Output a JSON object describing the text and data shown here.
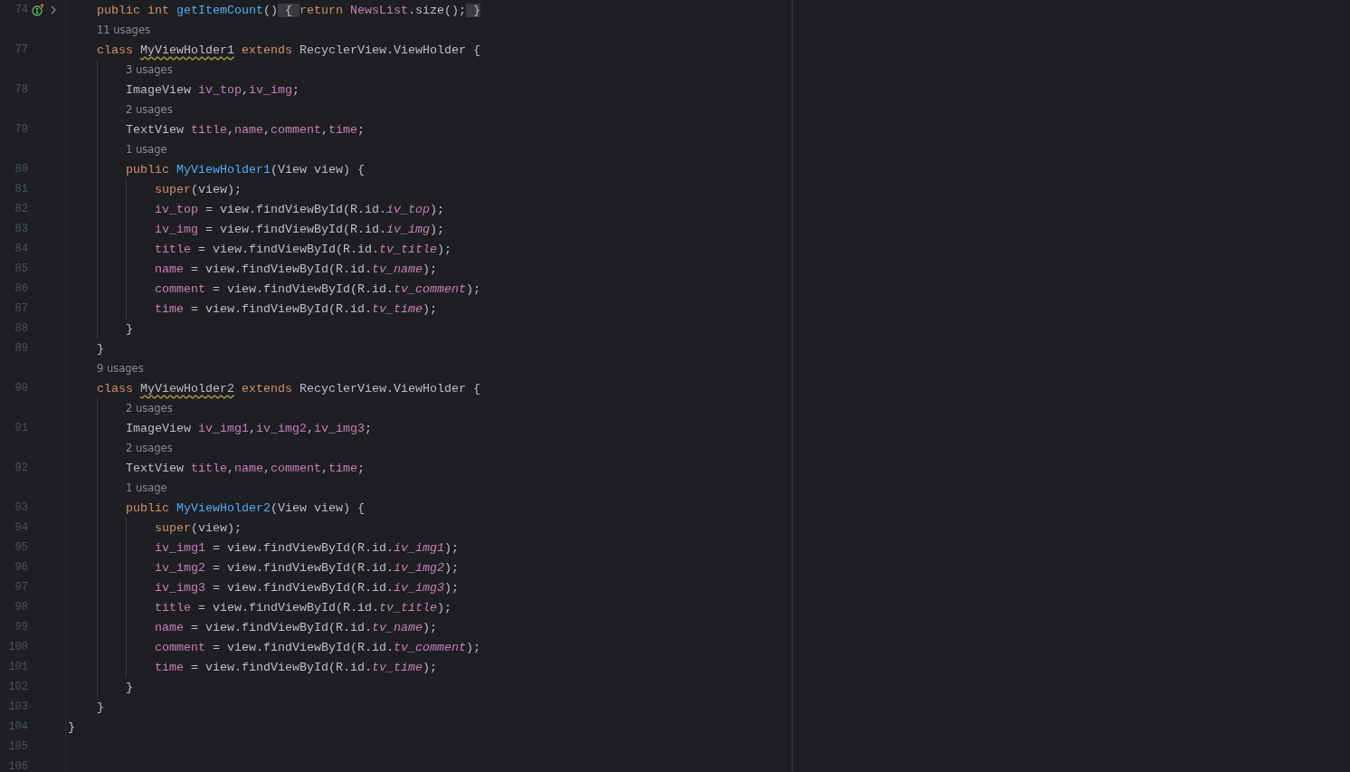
{
  "editor": {
    "lines": [
      {
        "number": "74",
        "markers": true,
        "tokens": [
          {
            "kind": "keyword",
            "text": "    public int "
          },
          {
            "kind": "method",
            "text": "getItemCount"
          },
          {
            "kind": "plain",
            "text": "()"
          },
          {
            "kind": "fold",
            "text": " { "
          },
          {
            "kind": "keyword",
            "text": "return "
          },
          {
            "kind": "field",
            "text": "NewsList"
          },
          {
            "kind": "plain",
            "text": ".size();"
          },
          {
            "kind": "fold",
            "text": " }"
          }
        ]
      },
      {
        "hint": "11 usages"
      },
      {
        "number": "77",
        "tokens": [
          {
            "kind": "keyword",
            "text": "    class "
          },
          {
            "kind": "warn",
            "text": "MyViewHolder1"
          },
          {
            "kind": "keyword",
            "text": " extends "
          },
          {
            "kind": "plain",
            "text": "RecyclerView.ViewHolder {"
          }
        ]
      },
      {
        "hint": "3 usages"
      },
      {
        "number": "78",
        "tokens": [
          {
            "kind": "plain",
            "text": "        ImageView "
          },
          {
            "kind": "field",
            "text": "iv_top"
          },
          {
            "kind": "plain",
            "text": ","
          },
          {
            "kind": "field",
            "text": "iv_img"
          },
          {
            "kind": "plain",
            "text": ";"
          }
        ]
      },
      {
        "hint": "2 usages"
      },
      {
        "number": "79",
        "tokens": [
          {
            "kind": "plain",
            "text": "        TextView "
          },
          {
            "kind": "field",
            "text": "title"
          },
          {
            "kind": "plain",
            "text": ","
          },
          {
            "kind": "field",
            "text": "name"
          },
          {
            "kind": "plain",
            "text": ","
          },
          {
            "kind": "field",
            "text": "comment"
          },
          {
            "kind": "plain",
            "text": ","
          },
          {
            "kind": "field",
            "text": "time"
          },
          {
            "kind": "plain",
            "text": ";"
          }
        ]
      },
      {
        "hint": "1 usage"
      },
      {
        "number": "80",
        "tokens": [
          {
            "kind": "keyword",
            "text": "        public "
          },
          {
            "kind": "method",
            "text": "MyViewHolder1"
          },
          {
            "kind": "plain",
            "text": "(View view) {"
          }
        ]
      },
      {
        "number": "81",
        "tokens": [
          {
            "kind": "keyword",
            "text": "            super"
          },
          {
            "kind": "plain",
            "text": "(view);"
          }
        ]
      },
      {
        "number": "82",
        "tokens": [
          {
            "kind": "field",
            "text": "            iv_top"
          },
          {
            "kind": "plain",
            "text": " = view.findViewById(R.id."
          },
          {
            "kind": "static",
            "text": "iv_top"
          },
          {
            "kind": "plain",
            "text": ");"
          }
        ]
      },
      {
        "number": "83",
        "tokens": [
          {
            "kind": "field",
            "text": "            iv_img"
          },
          {
            "kind": "plain",
            "text": " = view.findViewById(R.id."
          },
          {
            "kind": "static",
            "text": "iv_img"
          },
          {
            "kind": "plain",
            "text": ");"
          }
        ]
      },
      {
        "number": "84",
        "tokens": [
          {
            "kind": "field",
            "text": "            title"
          },
          {
            "kind": "plain",
            "text": " = view.findViewById(R.id."
          },
          {
            "kind": "static",
            "text": "tv_title"
          },
          {
            "kind": "plain",
            "text": ");"
          }
        ]
      },
      {
        "number": "85",
        "tokens": [
          {
            "kind": "field",
            "text": "            name"
          },
          {
            "kind": "plain",
            "text": " = view.findViewById(R.id."
          },
          {
            "kind": "static",
            "text": "tv_name"
          },
          {
            "kind": "plain",
            "text": ");"
          }
        ]
      },
      {
        "number": "86",
        "tokens": [
          {
            "kind": "field",
            "text": "            comment"
          },
          {
            "kind": "plain",
            "text": " = view.findViewById(R.id."
          },
          {
            "kind": "static",
            "text": "tv_comment"
          },
          {
            "kind": "plain",
            "text": ");"
          }
        ]
      },
      {
        "number": "87",
        "tokens": [
          {
            "kind": "field",
            "text": "            time"
          },
          {
            "kind": "plain",
            "text": " = view.findViewById(R.id."
          },
          {
            "kind": "static",
            "text": "tv_time"
          },
          {
            "kind": "plain",
            "text": ");"
          }
        ]
      },
      {
        "number": "88",
        "tokens": [
          {
            "kind": "plain",
            "text": "        }"
          }
        ]
      },
      {
        "number": "89",
        "tokens": [
          {
            "kind": "plain",
            "text": "    }"
          }
        ]
      },
      {
        "hint": "9 usages"
      },
      {
        "number": "90",
        "tokens": [
          {
            "kind": "keyword",
            "text": "    class "
          },
          {
            "kind": "warn",
            "text": "MyViewHolder2"
          },
          {
            "kind": "keyword",
            "text": " extends "
          },
          {
            "kind": "plain",
            "text": "RecyclerView.ViewHolder {"
          }
        ]
      },
      {
        "hint": "2 usages"
      },
      {
        "number": "91",
        "tokens": [
          {
            "kind": "plain",
            "text": "        ImageView "
          },
          {
            "kind": "field",
            "text": "iv_img1"
          },
          {
            "kind": "plain",
            "text": ","
          },
          {
            "kind": "field",
            "text": "iv_img2"
          },
          {
            "kind": "plain",
            "text": ","
          },
          {
            "kind": "field",
            "text": "iv_img3"
          },
          {
            "kind": "plain",
            "text": ";"
          }
        ]
      },
      {
        "hint": "2 usages"
      },
      {
        "number": "92",
        "tokens": [
          {
            "kind": "plain",
            "text": "        TextView "
          },
          {
            "kind": "field",
            "text": "title"
          },
          {
            "kind": "plain",
            "text": ","
          },
          {
            "kind": "field",
            "text": "name"
          },
          {
            "kind": "plain",
            "text": ","
          },
          {
            "kind": "field",
            "text": "comment"
          },
          {
            "kind": "plain",
            "text": ","
          },
          {
            "kind": "field",
            "text": "time"
          },
          {
            "kind": "plain",
            "text": ";"
          }
        ]
      },
      {
        "hint": "1 usage"
      },
      {
        "number": "93",
        "tokens": [
          {
            "kind": "keyword",
            "text": "        public "
          },
          {
            "kind": "method",
            "text": "MyViewHolder2"
          },
          {
            "kind": "plain",
            "text": "(View view) {"
          }
        ]
      },
      {
        "number": "94",
        "tokens": [
          {
            "kind": "keyword",
            "text": "            super"
          },
          {
            "kind": "plain",
            "text": "(view);"
          }
        ]
      },
      {
        "number": "95",
        "tokens": [
          {
            "kind": "field",
            "text": "            iv_img1"
          },
          {
            "kind": "plain",
            "text": " = view.findViewById(R.id."
          },
          {
            "kind": "static",
            "text": "iv_img1"
          },
          {
            "kind": "plain",
            "text": ");"
          }
        ]
      },
      {
        "number": "96",
        "tokens": [
          {
            "kind": "field",
            "text": "            iv_img2"
          },
          {
            "kind": "plain",
            "text": " = view.findViewById(R.id."
          },
          {
            "kind": "static",
            "text": "iv_img2"
          },
          {
            "kind": "plain",
            "text": ");"
          }
        ]
      },
      {
        "number": "97",
        "tokens": [
          {
            "kind": "field",
            "text": "            iv_img3"
          },
          {
            "kind": "plain",
            "text": " = view.findViewById(R.id."
          },
          {
            "kind": "static",
            "text": "iv_img3"
          },
          {
            "kind": "plain",
            "text": ");"
          }
        ]
      },
      {
        "number": "98",
        "tokens": [
          {
            "kind": "field",
            "text": "            title"
          },
          {
            "kind": "plain",
            "text": " = view.findViewById(R.id."
          },
          {
            "kind": "static",
            "text": "tv_title"
          },
          {
            "kind": "plain",
            "text": ");"
          }
        ]
      },
      {
        "number": "99",
        "tokens": [
          {
            "kind": "field",
            "text": "            name"
          },
          {
            "kind": "plain",
            "text": " = view.findViewById(R.id."
          },
          {
            "kind": "static",
            "text": "tv_name"
          },
          {
            "kind": "plain",
            "text": ");"
          }
        ]
      },
      {
        "number": "100",
        "tokens": [
          {
            "kind": "field",
            "text": "            comment"
          },
          {
            "kind": "plain",
            "text": " = view.findViewById(R.id."
          },
          {
            "kind": "static",
            "text": "tv_comment"
          },
          {
            "kind": "plain",
            "text": ");"
          }
        ]
      },
      {
        "number": "101",
        "tokens": [
          {
            "kind": "field",
            "text": "            time"
          },
          {
            "kind": "plain",
            "text": " = view.findViewById(R.id."
          },
          {
            "kind": "static",
            "text": "tv_time"
          },
          {
            "kind": "plain",
            "text": ");"
          }
        ]
      },
      {
        "number": "102",
        "tokens": [
          {
            "kind": "plain",
            "text": "        }"
          }
        ]
      },
      {
        "number": "103",
        "tokens": [
          {
            "kind": "plain",
            "text": "    }"
          }
        ]
      },
      {
        "number": "104",
        "tokens": [
          {
            "kind": "plain",
            "text": "}"
          }
        ]
      },
      {
        "number": "105"
      },
      {
        "number": "106"
      }
    ]
  }
}
